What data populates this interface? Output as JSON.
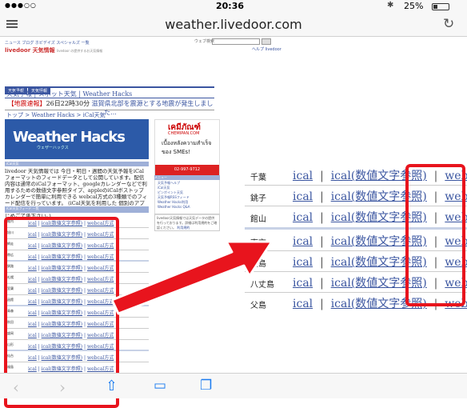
{
  "status_bar": {
    "carrier": "●●●○○",
    "time": "20:36",
    "bluetooth": "✱",
    "battery_pct": "25%",
    "battery_level": 0.25
  },
  "address_bar": {
    "url": "weather.livedoor.com"
  },
  "page": {
    "topnav": "ニュース ブログ ホビデイズ スペシャルズ 一覧",
    "search_label": "ウェブ検索",
    "logo": "livedoor 天気情報",
    "logo_tagline": "livedoor の提供するお天気情報",
    "help_links": "ヘルプ  livedoor",
    "tabs": [
      "天気予報",
      "天気情報"
    ],
    "sublinks": "天気予報 | スポット天気 | Weather Hacks",
    "alert_prefix": "【地震速報】",
    "alert_time": "26日22時30分",
    "alert_link": "滋賀県北部を震源とする地震が発生しました...",
    "breadcrumb": "トップ > Weather Hacks > iCal天気",
    "banner_title": "Weather Hacks",
    "banner_sub": "ウェザーハックス",
    "section_header": "iCal天気",
    "description": "livedoor 天気情報では 今日・明日・週間の天気予報をiCalフォーマットのフィードデータとして公開しています。配信内容は通常のiCalフォーマット、googleカレンダーなどで利用するための数値文字参照タイプ、appleのiCalボストップカレンダーで簡単に利用できる webcal方式の3種類でのフィード配信を行っています。 (iCal天気を利用した 個別のアプリケーションでの設定についてはお答えできません。あらかじめご了承下さい。)",
    "list_header": "iCal天気フィード 一覧",
    "small_rows": [
      {
        "city": "稚内",
        "ical": "ical",
        "ical_num": "ical(数値文字参照)",
        "webcal": "webcal方式"
      },
      {
        "city": "旭川",
        "ical": "ical",
        "ical_num": "ical(数値文字参照)",
        "webcal": "webcal方式"
      },
      {
        "city": "網走",
        "ical": "ical",
        "ical_num": "ical(数値文字参照)",
        "webcal": "webcal方式"
      },
      {
        "city": "帯広",
        "ical": "ical",
        "ical_num": "ical(数値文字参照)",
        "webcal": "webcal方式"
      },
      {
        "city": "釧路",
        "ical": "ical",
        "ical_num": "ical(数値文字参照)",
        "webcal": "webcal方式"
      },
      {
        "city": "札幌",
        "ical": "ical",
        "ical_num": "ical(数値文字参照)",
        "webcal": "webcal方式"
      },
      {
        "city": "室蘭",
        "ical": "ical",
        "ical_num": "ical(数値文字参照)",
        "webcal": "webcal方式"
      },
      {
        "city": "函館",
        "ical": "ical",
        "ical_num": "ical(数値文字参照)",
        "webcal": "webcal方式"
      },
      {
        "city": "青森",
        "ical": "ical",
        "ical_num": "ical(数値文字参照)",
        "webcal": "webcal方式"
      },
      {
        "city": "秋田",
        "ical": "ical",
        "ical_num": "ical(数値文字参照)",
        "webcal": "webcal方式"
      },
      {
        "city": "盛岡",
        "ical": "ical",
        "ical_num": "ical(数値文字参照)",
        "webcal": "webcal方式"
      },
      {
        "city": "山形",
        "ical": "ical",
        "ical_num": "ical(数値文字参照)",
        "webcal": "webcal方式"
      },
      {
        "city": "仙台",
        "ical": "ical",
        "ical_num": "ical(数値文字参照)",
        "webcal": "webcal方式"
      },
      {
        "city": "福島",
        "ical": "ical",
        "ical_num": "ical(数値文字参照)",
        "webcal": "webcal方式"
      },
      {
        "city": "新潟",
        "ical": "ical",
        "ical_num": "ical(数値文字参照)",
        "webcal": "webcal方式"
      },
      {
        "city": "長野",
        "ical": "ical",
        "ical_num": "ical(数値文字参照)",
        "webcal": "webcal方式"
      }
    ],
    "ad": {
      "logo": "เคมีภัณฑ์",
      "site": "CHEMIPAN.COM",
      "tagline": "เบื้องหลังความสำเร็จของ SMEs!",
      "phone": "02-997-9712",
      "menu_header": "メニュー",
      "menu_items": [
        "天気予報ヘルプ",
        "iCal天気",
        "ピンポイント天気",
        "天気予報RSSフィード",
        "Weather Hacks利用",
        "Weather Hacks Q&A"
      ],
      "bottom_note": "livedoor天気情報では天気データの提供を行っております。詳細は利用規約をご確認ください。",
      "bottom_link": "利用規約"
    }
  },
  "zoom": {
    "rows": [
      {
        "city": "千葉",
        "ical": "ical",
        "sep": "|",
        "ical_num": "ical(数値文字参照)",
        "webcal": "webcal方式"
      },
      {
        "city": "銚子",
        "ical": "ical",
        "sep": "|",
        "ical_num": "ical(数値文字参照)",
        "webcal": "webcal方式"
      },
      {
        "city": "館山",
        "ical": "ical",
        "sep": "|",
        "ical_num": "ical(数値文字参照)",
        "webcal": "webcal方式"
      },
      {
        "city": "東京",
        "ical": "ical",
        "sep": "|",
        "ical_num": "ical(数値文字参照)",
        "webcal": "webcal方式"
      },
      {
        "city": "大島",
        "ical": "ical",
        "sep": "|",
        "ical_num": "ical(数値文字参照)",
        "webcal": "webcal方式"
      },
      {
        "city": "八丈島",
        "ical": "ical",
        "sep": "|",
        "ical_num": "ical(数値文字参照)",
        "webcal": "webcal方式"
      },
      {
        "city": "父島",
        "ical": "ical",
        "sep": "|",
        "ical_num": "ical(数値文字参照)",
        "webcal": "webcal方式"
      }
    ]
  },
  "toolbar": {
    "back_icon": "chevron-left-icon",
    "forward_icon": "chevron-right-icon",
    "share_icon": "share-icon",
    "bookmarks_icon": "book-icon",
    "tabs_icon": "tabs-icon"
  },
  "colors": {
    "highlight": "#e8141d",
    "link": "#3a55a0",
    "ios_blue": "#1a7bf0"
  }
}
